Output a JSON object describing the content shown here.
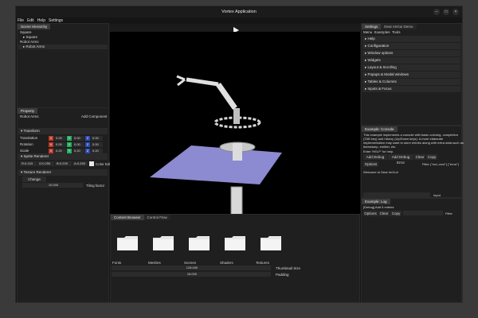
{
  "window": {
    "title": "Vortex Application"
  },
  "menubar": [
    "File",
    "Edit",
    "Help",
    "Settings"
  ],
  "hierarchy": {
    "tab": "Scene Hierarchy",
    "root": "Square",
    "child": "Square",
    "item2": "Robot Arms",
    "item3": "Robot Arms"
  },
  "property": {
    "tab": "Property",
    "entity_name": "Robot Arms",
    "add_component": "Add Component",
    "transform": {
      "title": "Transform",
      "rows": [
        {
          "label": "Translation",
          "x": "0.00",
          "y": "0.00",
          "z": "0.00"
        },
        {
          "label": "Rotation",
          "x": "0.00",
          "y": "0.00",
          "z": "0.00"
        },
        {
          "label": "Scale",
          "x": "0.20",
          "y": "0.20",
          "z": "0.20"
        }
      ],
      "axis_x": "X",
      "axis_y": "Y",
      "axis_z": "Z"
    },
    "sprite": {
      "title": "Sprite Renderer",
      "r": "R:0.243",
      "g": "G:0.255",
      "b": "B:0.239",
      "a": "A:0.255",
      "color_edit": "Color Edit"
    },
    "texture": {
      "title": "Texture Renderer",
      "change": "Change Texture",
      "tiling_value": "10.000",
      "tiling_label": "Tiling factor"
    }
  },
  "settings": {
    "tabs": [
      "Settings",
      "Dear ImGui Demo"
    ],
    "menu": [
      "Menu",
      "Examples",
      "Tools"
    ],
    "items": [
      "Help",
      "Configuration",
      "Window options",
      "Widgets",
      "Layout & Scrolling",
      "Popups & Modal windows",
      "Tables & Columns",
      "Inputs & Focus"
    ]
  },
  "console": {
    "tab": "Example: Console",
    "desc1": "This example implements a console with basic coloring, completion",
    "desc2": "(TAB key) and history (Up/Down keys). A more elaborate",
    "desc3": "implementation may want to store entries along with extra data such as",
    "desc4": "timestamp, emitter, etc.",
    "help": "Enter 'HELP' for help.",
    "buttons": [
      "Add Debug Text",
      "Add Debug Error",
      "Clear",
      "Copy"
    ],
    "options": "Options",
    "filter": "Filter (\"incl,-excl\") (\"error\")",
    "welcome": "Welcome to Dear ImGui!",
    "input": "Input"
  },
  "log": {
    "tab": "Example: Log",
    "line": "[Debug] Add 5 entries",
    "buttons": [
      "Options",
      "Clear",
      "Copy"
    ],
    "filter": "Filter"
  },
  "browser": {
    "tabs": [
      "Content Browser",
      "Control Flow"
    ],
    "folders": [
      "Fonts",
      "Meshes",
      "Scenes",
      "Shaders",
      "Textures"
    ],
    "back": "<-",
    "thumb_value": "128.000",
    "thumb_label": "Thumbnail Size",
    "padding_value": "16.000",
    "padding_label": "Padding"
  },
  "colors": {
    "axis_x": "#c0392b",
    "axis_y": "#27ae60",
    "axis_z": "#2c4bb5",
    "plane": "#8c8ad0"
  }
}
